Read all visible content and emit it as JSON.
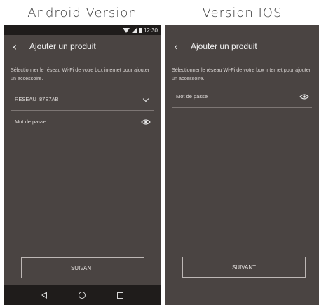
{
  "captions": {
    "android": "Android Version",
    "ios": "Version IOS"
  },
  "android": {
    "status_time": "12:30",
    "title": "Ajouter un produit",
    "description": "Sélectionner le réseau Wi-Fi de votre box internet pour ajouter un accessoire.",
    "network_field": {
      "value": "RESEAU_87E7AB"
    },
    "password_field": {
      "placeholder": "Mot de passe"
    },
    "next_button": "SUIVANT"
  },
  "ios": {
    "title": "Ajouter un produit",
    "description": "Sélectionner le réseau Wi-Fi de votre box internet pour ajouter un accessoire.",
    "password_field": {
      "placeholder": "Mot de passe"
    },
    "next_button": "SUIVANT"
  },
  "colors": {
    "screen_bg": "#4a4442",
    "bar_bg": "#1f1c1b",
    "divider": "#7d7674"
  },
  "icons": [
    "back-chevron-icon",
    "chevron-down-icon",
    "eye-icon",
    "wifi-icon",
    "signal-icon",
    "battery-icon",
    "nav-back-icon",
    "nav-home-icon",
    "nav-recent-icon"
  ]
}
